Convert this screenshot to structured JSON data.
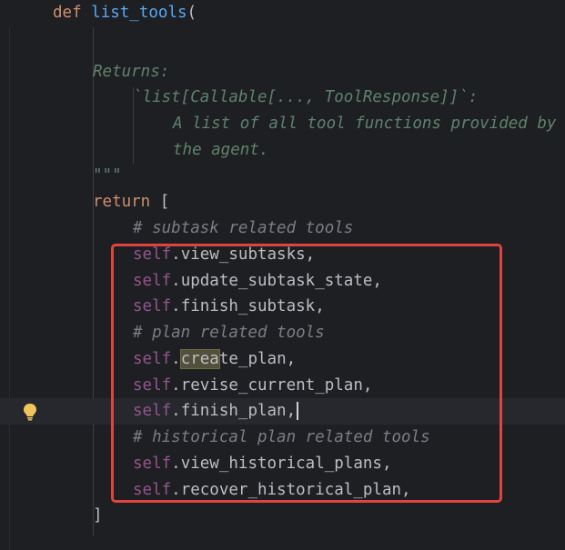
{
  "editor": {
    "lines": [
      {
        "id": "def",
        "parts": [
          {
            "cls": "kw",
            "text": "def "
          },
          {
            "cls": "fn",
            "text": "list_tools"
          },
          {
            "cls": "plain",
            "text": "("
          }
        ]
      },
      {
        "id": "returns",
        "parts": [
          {
            "cls": "docstring",
            "text": "Returns:"
          }
        ]
      },
      {
        "id": "ret-type",
        "parts": [
          {
            "cls": "docstring",
            "text": "`list[Callable[..., ToolResponse]]`:"
          }
        ]
      },
      {
        "id": "ret-desc1",
        "parts": [
          {
            "cls": "docstring",
            "text": "A list of all tool functions provided by"
          }
        ]
      },
      {
        "id": "ret-desc2",
        "parts": [
          {
            "cls": "docstring",
            "text": "the agent."
          }
        ]
      },
      {
        "id": "doc-end",
        "parts": [
          {
            "cls": "docstring",
            "text": "\"\"\""
          }
        ]
      },
      {
        "id": "return",
        "parts": [
          {
            "cls": "kw",
            "text": "return "
          },
          {
            "cls": "plain",
            "text": "["
          }
        ]
      },
      {
        "id": "c-subtask",
        "parts": [
          {
            "cls": "comment",
            "text": "# subtask related tools"
          }
        ]
      },
      {
        "id": "view-subtasks",
        "parts": [
          {
            "cls": "self",
            "text": "self"
          },
          {
            "cls": "plain",
            "text": ".view_subtasks,"
          }
        ]
      },
      {
        "id": "update-subtask",
        "parts": [
          {
            "cls": "self",
            "text": "self"
          },
          {
            "cls": "plain",
            "text": ".update_subtask_state,"
          }
        ]
      },
      {
        "id": "finish-subtask",
        "parts": [
          {
            "cls": "self",
            "text": "self"
          },
          {
            "cls": "plain",
            "text": ".finish_subtask,"
          }
        ]
      },
      {
        "id": "c-plan",
        "parts": [
          {
            "cls": "comment",
            "text": "# plan related tools"
          }
        ]
      },
      {
        "id": "create-plan",
        "parts": [
          {
            "cls": "self",
            "text": "self"
          },
          {
            "cls": "plain",
            "text": "."
          },
          {
            "cls": "hl",
            "text": "crea"
          },
          {
            "cls": "plain",
            "text": "te_plan,"
          }
        ]
      },
      {
        "id": "revise-plan",
        "parts": [
          {
            "cls": "self",
            "text": "self"
          },
          {
            "cls": "plain",
            "text": ".revise_current_plan,"
          }
        ]
      },
      {
        "id": "finish-plan",
        "parts": [
          {
            "cls": "self",
            "text": "self"
          },
          {
            "cls": "plain",
            "text": ".finish_plan,"
          }
        ]
      },
      {
        "id": "c-historical",
        "parts": [
          {
            "cls": "comment",
            "text": "# historical plan related tools"
          }
        ]
      },
      {
        "id": "view-historical",
        "parts": [
          {
            "cls": "self",
            "text": "self"
          },
          {
            "cls": "plain",
            "text": ".view_historical_plans,"
          }
        ]
      },
      {
        "id": "recover-historical",
        "parts": [
          {
            "cls": "self",
            "text": "self"
          },
          {
            "cls": "plain",
            "text": ".recover_historical_plan,"
          }
        ]
      },
      {
        "id": "close-bracket",
        "parts": [
          {
            "cls": "plain",
            "text": "]"
          }
        ]
      }
    ]
  },
  "icons": {
    "intention": "lightbulb-icon"
  },
  "colors": {
    "background": "#1e1f22",
    "keyword": "#cf8e6d",
    "function": "#56a8f5",
    "self": "#94558d",
    "comment": "#7a7e85",
    "docstring": "#5f826b",
    "selection_box": "#e0443e",
    "bulb": "#f2c55c"
  }
}
